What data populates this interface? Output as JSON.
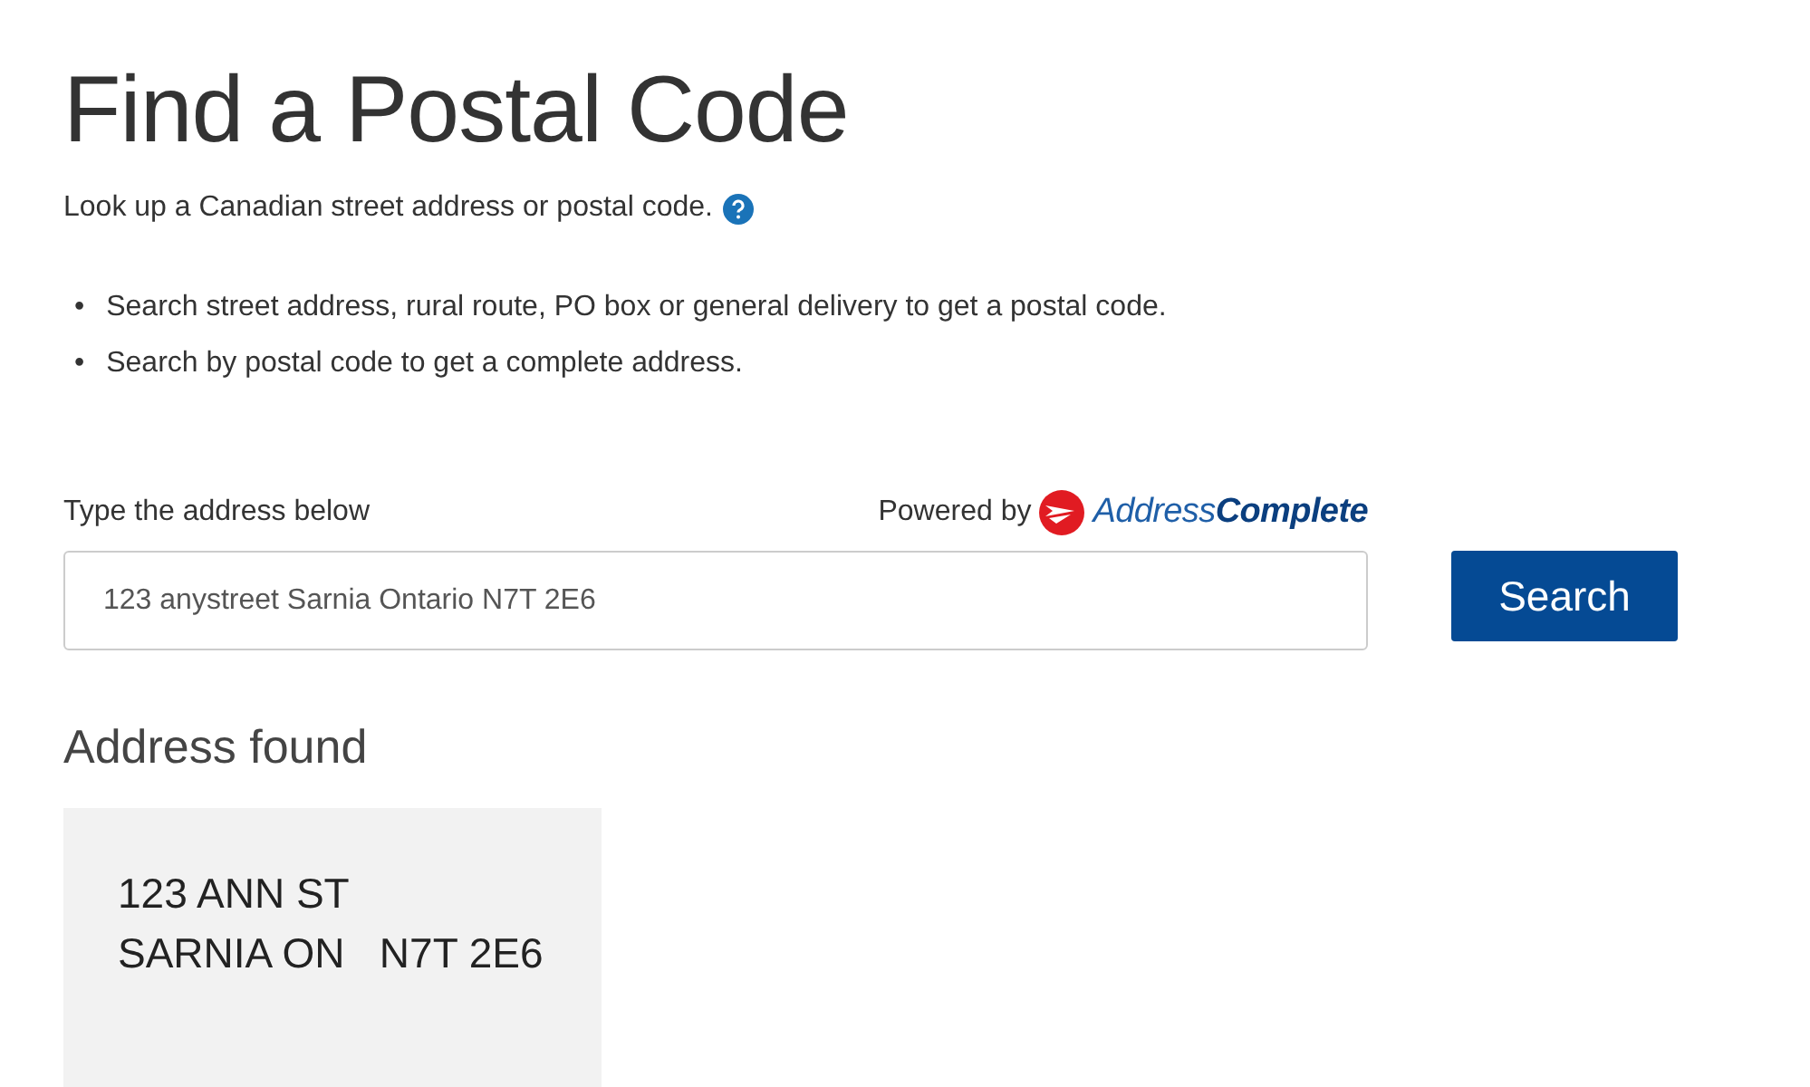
{
  "title": "Find a Postal Code",
  "intro": "Look up a Canadian street address or postal code.",
  "bullets": [
    {
      "marker": "•",
      "text": "Search street address, rural route, PO box or general delivery to get a postal code."
    },
    {
      "marker": "•",
      "text": "Search by postal code to get a complete address."
    }
  ],
  "search": {
    "label": "Type the address below",
    "powered_by": "Powered by",
    "brand": "Address**Complete**",
    "value": "123 anystreet Sarnia Ontario N7T 2E6",
    "button": "Search"
  },
  "result": {
    "heading": "Address found",
    "lines": [
      "123 ANN ST",
      "SARNIA ON   N7T 2E6"
    ]
  }
}
